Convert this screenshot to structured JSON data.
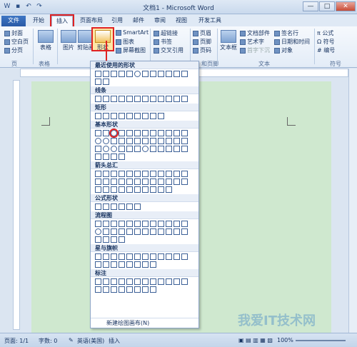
{
  "window": {
    "title": "文档1 - Microsoft Word",
    "minimize": "—",
    "maximize": "□",
    "close": "✕"
  },
  "tabs": [
    "文件",
    "开始",
    "插入",
    "页面布局",
    "引用",
    "邮件",
    "审阅",
    "视图",
    "开发工具"
  ],
  "ribbon": {
    "page_items": [
      "封面",
      "空白页",
      "分页"
    ],
    "page_group": "页",
    "table": "表格",
    "table_group": "表格",
    "picture": "图片",
    "clipart": "剪贴画",
    "shapes": "形状",
    "smartart": "SmartArt",
    "chart": "图表",
    "screenshot": "屏幕截图",
    "hyperlink": "超链接",
    "bookmark": "书签",
    "crossref": "交叉引用",
    "header": "页眉",
    "footer": "页脚",
    "pagenum": "页码",
    "hf_group": "和页脚",
    "textbox": "文本框",
    "docparts": "文档部件",
    "wordart": "艺术字",
    "dropcap": "首字下沉",
    "sigline": "签名行",
    "datetime": "日期和时间",
    "object": "对象",
    "text_group": "文本",
    "equation": "公式",
    "symbol": "符号",
    "number": "编号",
    "symbol_group": "符号"
  },
  "menu": {
    "sections": [
      "最近使用的形状",
      "线条",
      "矩形",
      "基本形状",
      "箭头总汇",
      "公式形状",
      "流程图",
      "星与旗帜",
      "标注"
    ],
    "new_canvas": "新建绘图画布(N)"
  },
  "status": {
    "page": "页面: 1/1",
    "words": "字数: 0",
    "lang": "英语(美国)",
    "insert": "插入",
    "zoom": "100%"
  },
  "watermark": "我爱IT技术网"
}
